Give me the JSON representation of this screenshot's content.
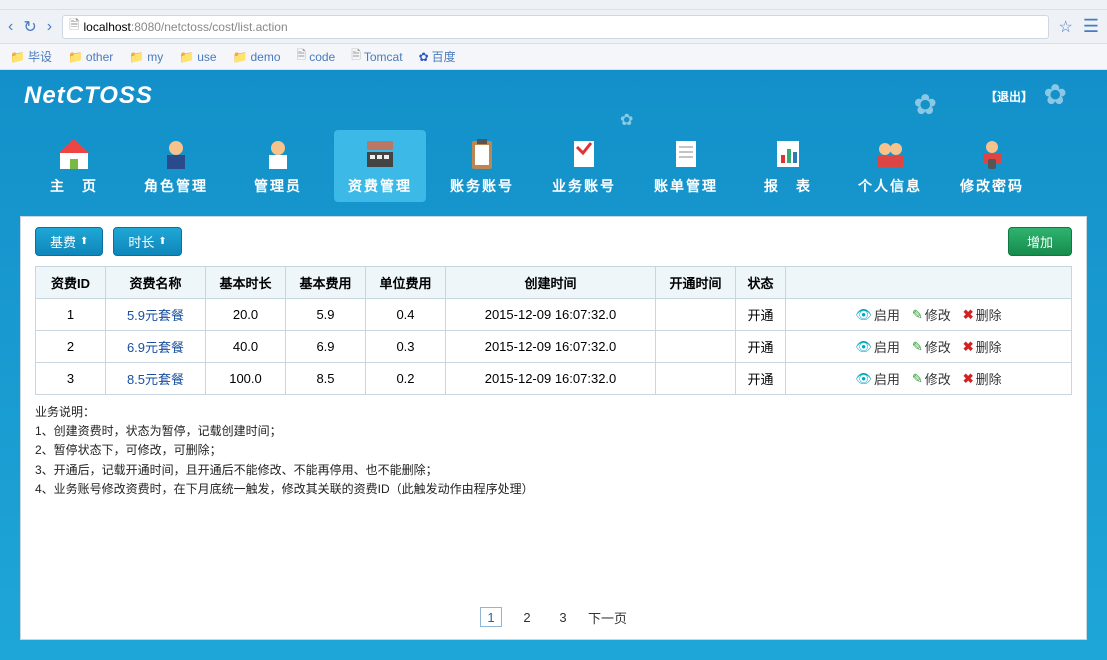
{
  "browser": {
    "url_prefix": "localhost",
    "url_suffix": ":8080/netctoss/cost/list.action",
    "bookmarks": [
      "毕设",
      "other",
      "my",
      "use",
      "demo",
      "code",
      "Tomcat",
      "百度"
    ]
  },
  "app": {
    "logo": "NetCTOSS",
    "logout": "退出"
  },
  "nav": [
    {
      "label": "主　页"
    },
    {
      "label": "角色管理"
    },
    {
      "label": "管理员"
    },
    {
      "label": "资费管理"
    },
    {
      "label": "账务账号"
    },
    {
      "label": "业务账号"
    },
    {
      "label": "账单管理"
    },
    {
      "label": "报　表"
    },
    {
      "label": "个人信息"
    },
    {
      "label": "修改密码"
    }
  ],
  "toolbar": {
    "sort_fee": "基费",
    "sort_time": "时长",
    "add": "增加"
  },
  "columns": {
    "c0": "资费ID",
    "c1": "资费名称",
    "c2": "基本时长",
    "c3": "基本费用",
    "c4": "单位费用",
    "c5": "创建时间",
    "c6": "开通时间",
    "c7": "状态",
    "c8": ""
  },
  "rows": [
    {
      "id": "1",
      "name": "5.9元套餐",
      "dur": "20.0",
      "base": "5.9",
      "unit": "0.4",
      "ctime": "2015-12-09 16:07:32.0",
      "otime": "",
      "status": "开通"
    },
    {
      "id": "2",
      "name": "6.9元套餐",
      "dur": "40.0",
      "base": "6.9",
      "unit": "0.3",
      "ctime": "2015-12-09 16:07:32.0",
      "otime": "",
      "status": "开通"
    },
    {
      "id": "3",
      "name": "8.5元套餐",
      "dur": "100.0",
      "base": "8.5",
      "unit": "0.2",
      "ctime": "2015-12-09 16:07:32.0",
      "otime": "",
      "status": "开通"
    }
  ],
  "actions": {
    "enable": "启用",
    "edit": "修改",
    "delete": "删除"
  },
  "notes": {
    "title": "业务说明：",
    "l1": "1、创建资费时，状态为暂停，记载创建时间；",
    "l2": "2、暂停状态下，可修改，可删除；",
    "l3": "3、开通后，记载开通时间，且开通后不能修改、不能再停用、也不能删除；",
    "l4": "4、业务账号修改资费时，在下月底统一触发，修改其关联的资费ID（此触发动作由程序处理）"
  },
  "pager": {
    "p1": "1",
    "p2": "2",
    "p3": "3",
    "next": "下一页"
  }
}
